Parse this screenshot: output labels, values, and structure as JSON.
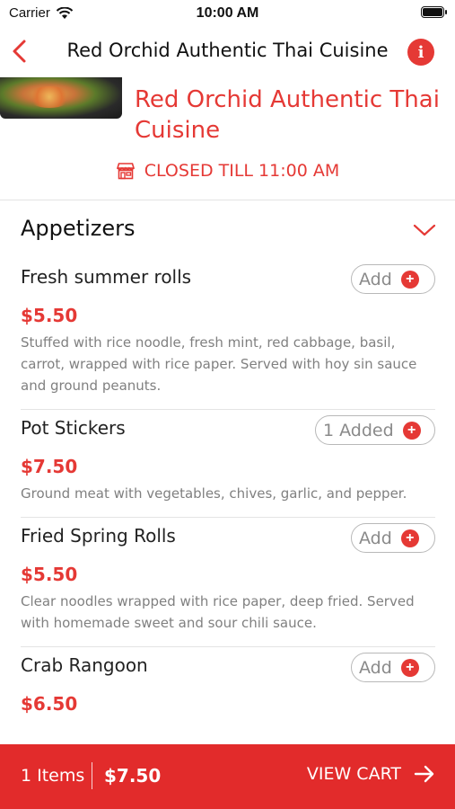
{
  "status_bar": {
    "carrier": "Carrier",
    "time": "10:00 AM"
  },
  "navbar": {
    "title": "Red Orchid Authentic Thai Cuisine",
    "back_icon": "chevron-left-icon",
    "info_icon": "info-icon"
  },
  "restaurant": {
    "name": "Red Orchid Authentic Thai Cuisine",
    "status": "CLOSED TILL 11:00 AM",
    "status_icon": "store-icon"
  },
  "menu": {
    "section_title": "Appetizers",
    "items": [
      {
        "name": "Fresh summer rolls",
        "price": "$5.50",
        "description": "Stuffed with rice noodle, fresh mint, red cabbage, basil, carrot, wrapped with rice paper. Served with hoy sin sauce and ground peanuts.",
        "button": "Add"
      },
      {
        "name": "Pot Stickers",
        "price": "$7.50",
        "description": "Ground meat with vegetables, chives, garlic, and pepper.",
        "button": "1 Added"
      },
      {
        "name": "Fried Spring Rolls",
        "price": "$5.50",
        "description": "Clear noodles wrapped with rice paper, deep fried. Served with homemade sweet and sour chili sauce.",
        "button": "Add"
      },
      {
        "name": "Crab Rangoon",
        "price": "$6.50",
        "description": "",
        "button": "Add"
      }
    ]
  },
  "cart": {
    "count": "1 Items",
    "total": "$7.50",
    "view_label": "VIEW CART"
  },
  "colors": {
    "accent": "#e53935",
    "cart_bar": "#e22b2b",
    "muted_text": "#808080"
  }
}
